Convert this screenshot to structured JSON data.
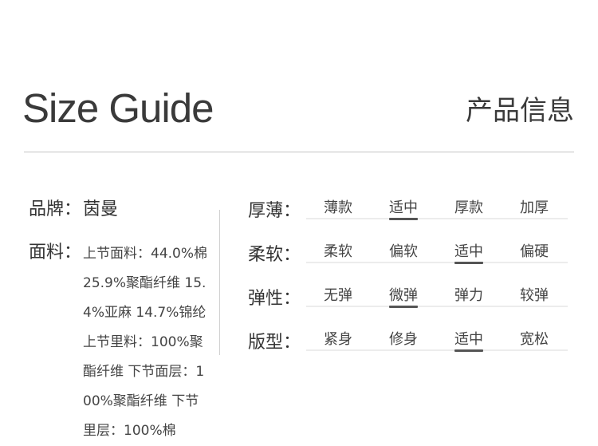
{
  "header": {
    "title_en": "Size Guide",
    "title_cn": "产品信息"
  },
  "brand": {
    "label": "品牌：",
    "value": "茵曼"
  },
  "fabric": {
    "label": "面料：",
    "value": "上节面料：44.0%棉25.9%聚酯纤维 15.4%亚麻 14.7%锦纶 上节里料：100%聚酯纤维 下节面层：100%聚酯纤维 下节里层：100%棉"
  },
  "properties": [
    {
      "label": "厚薄：",
      "options": [
        "薄款",
        "适中",
        "厚款",
        "加厚"
      ],
      "selected": 1
    },
    {
      "label": "柔软：",
      "options": [
        "柔软",
        "偏软",
        "适中",
        "偏硬"
      ],
      "selected": 2
    },
    {
      "label": "弹性：",
      "options": [
        "无弹",
        "微弹",
        "弹力",
        "较弹"
      ],
      "selected": 1
    },
    {
      "label": "版型：",
      "options": [
        "紧身",
        "修身",
        "适中",
        "宽松"
      ],
      "selected": 2
    }
  ]
}
